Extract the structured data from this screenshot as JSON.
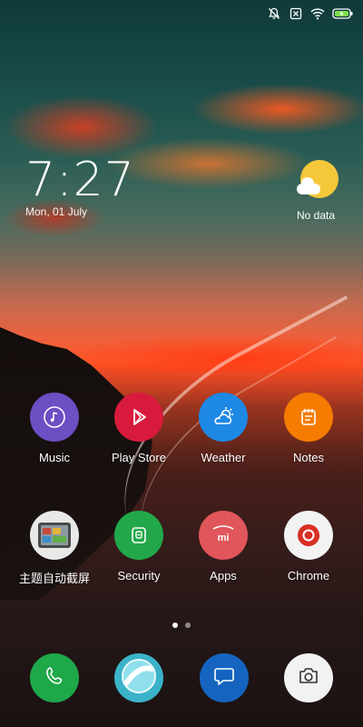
{
  "status_bar": {
    "icons": [
      "mute-icon",
      "sim-off-icon",
      "wifi-icon",
      "battery-charging-icon"
    ]
  },
  "clock": {
    "time": "7:27",
    "date": "Mon, 01 July"
  },
  "weather": {
    "text": "No data",
    "icon": "sun-cloud-icon"
  },
  "apps_row1": [
    {
      "label": "Music",
      "icon": "music-icon",
      "color": "#6b4fc3"
    },
    {
      "label": "Play Store",
      "icon": "play-store-icon",
      "color": "#d81b3c"
    },
    {
      "label": "Weather",
      "icon": "weather-icon",
      "color": "#1e88e5"
    },
    {
      "label": "Notes",
      "icon": "notes-icon",
      "color": "#f57c00"
    }
  ],
  "apps_row2": [
    {
      "label": "主题自动截屏",
      "icon": "theme-screenshot-icon",
      "color": "#5b5b5b"
    },
    {
      "label": "Security",
      "icon": "security-icon",
      "color": "#22a84a"
    },
    {
      "label": "Apps",
      "icon": "mi-apps-icon",
      "color": "#e0565a"
    },
    {
      "label": "Chrome",
      "icon": "chrome-icon",
      "color": "#f2f2f2"
    }
  ],
  "page_indicator": {
    "pages": 2,
    "current": 1
  },
  "dock": [
    {
      "name": "phone",
      "icon": "phone-icon",
      "color": "#1fa84a"
    },
    {
      "name": "browser",
      "icon": "browser-icon",
      "color": "#3bb3c9"
    },
    {
      "name": "messages",
      "icon": "message-icon",
      "color": "#1565c0"
    },
    {
      "name": "camera",
      "icon": "camera-icon",
      "color": "#f2f2f2"
    }
  ]
}
